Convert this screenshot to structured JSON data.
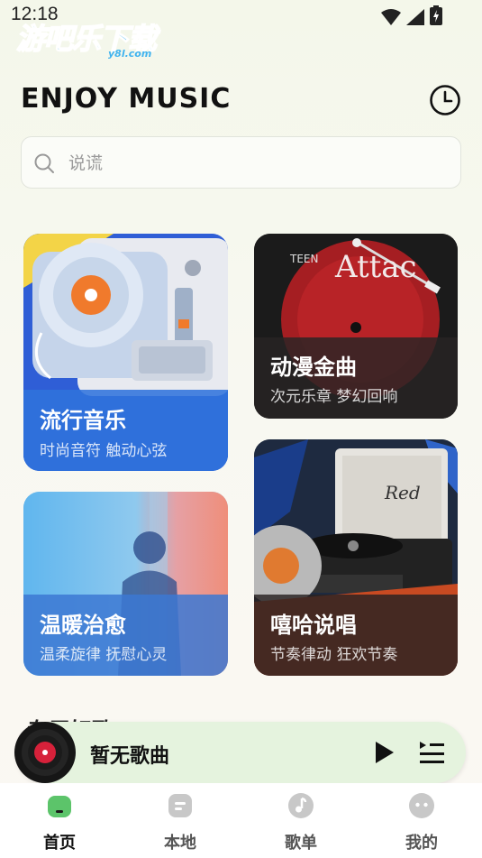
{
  "status_bar": {
    "time": "12:18"
  },
  "watermark": {
    "text": "游吧乐下载",
    "sub": "y8l.com"
  },
  "header": {
    "title": "ENJOY MUSIC"
  },
  "search": {
    "placeholder": "说谎"
  },
  "cards": [
    {
      "title": "流行音乐",
      "subtitle": "时尚音符 触动心弦"
    },
    {
      "title": "动漫金曲",
      "subtitle": "次元乐章 梦幻回响",
      "art_text": "Attac",
      "art_small": "TEEN"
    },
    {
      "title": "温暖治愈",
      "subtitle": "温柔旋律 抚慰心灵"
    },
    {
      "title": "嘻哈说唱",
      "subtitle": "节奏律动 狂欢节奏",
      "art_text": "Red"
    }
  ],
  "section": {
    "title": "专属好歌"
  },
  "player": {
    "title": "暂无歌曲"
  },
  "tabs": [
    {
      "label": "首页",
      "icon": "home-icon"
    },
    {
      "label": "本地",
      "icon": "local-icon"
    },
    {
      "label": "歌单",
      "icon": "playlist-icon"
    },
    {
      "label": "我的",
      "icon": "profile-icon"
    }
  ],
  "colors": {
    "accent": "#5cc46a",
    "player_bg": "#e5f3de",
    "tab_icon": "#c8c8c8"
  }
}
